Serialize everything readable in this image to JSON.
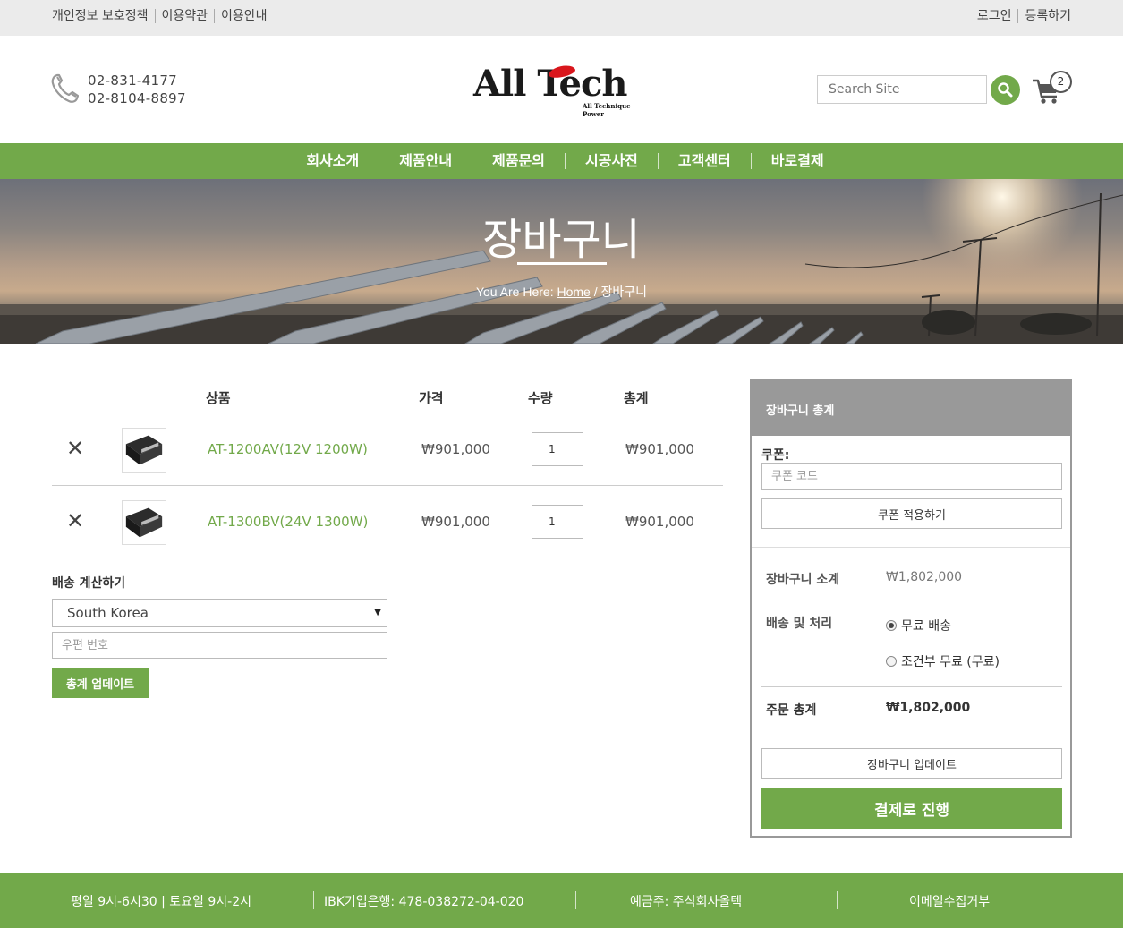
{
  "topbar": {
    "links": [
      "개인정보 보호정책",
      "이용약관",
      "이용안내"
    ],
    "login": "로그인",
    "register": "등록하기"
  },
  "header": {
    "phones": [
      "02-831-4177",
      "02-8104-8897"
    ],
    "logo_text": "All Tech",
    "logo_tagline": "All Technique Power",
    "search_placeholder": "Search Site",
    "cart_count": "2",
    "colors": {
      "accent": "#72a94a",
      "logo_red": "#d9161c"
    }
  },
  "nav": {
    "items": [
      "회사소개",
      "제품안내",
      "제품문의",
      "시공사진",
      "고객센터",
      "바로결제"
    ]
  },
  "hero": {
    "title": "장바구니",
    "crumb_prefix": "You Are Here:",
    "crumb_home": "Home",
    "crumb_sep": "/",
    "crumb_current": "장바구니"
  },
  "cart": {
    "headers": {
      "product": "상품",
      "price": "가격",
      "quantity": "수량",
      "total": "총계"
    },
    "rows": [
      {
        "name": "AT-1200AV(12V 1200W)",
        "price": "₩901,000",
        "quantity": "1",
        "total": "₩901,000"
      },
      {
        "name": "AT-1300BV(24V 1300W)",
        "price": "₩901,000",
        "quantity": "1",
        "total": "₩901,000"
      }
    ],
    "remove_symbol": "✕"
  },
  "shipping_calc": {
    "title": "배송 계산하기",
    "country": "South Korea",
    "postcode_placeholder": "우편 번호",
    "update_button": "총계 업데이트"
  },
  "totals": {
    "header": "장바구니 총계",
    "coupon_label": "쿠폰:",
    "coupon_placeholder": "쿠폰 코드",
    "coupon_button": "쿠폰 적용하기",
    "subtotal_label": "장바구니 소계",
    "subtotal_value": "₩1,802,000",
    "shipping_label": "배송 및 처리",
    "shipping_options": [
      "무료 배송",
      "조건부 무료 (무료)"
    ],
    "shipping_selected": "무료 배송",
    "order_total_label": "주문 총계",
    "order_total_value": "₩1,802,000",
    "update_cart_button": "장바구니 업데이트",
    "checkout_button": "결제로 진행"
  },
  "footer": {
    "hours": "평일 9시-6시30 | 토요일 9시-2시",
    "bank": "IBK기업은행: 478-038272-04-020",
    "holder": "예금주: 주식회사올텍",
    "email_policy": "이메일수집거부"
  }
}
